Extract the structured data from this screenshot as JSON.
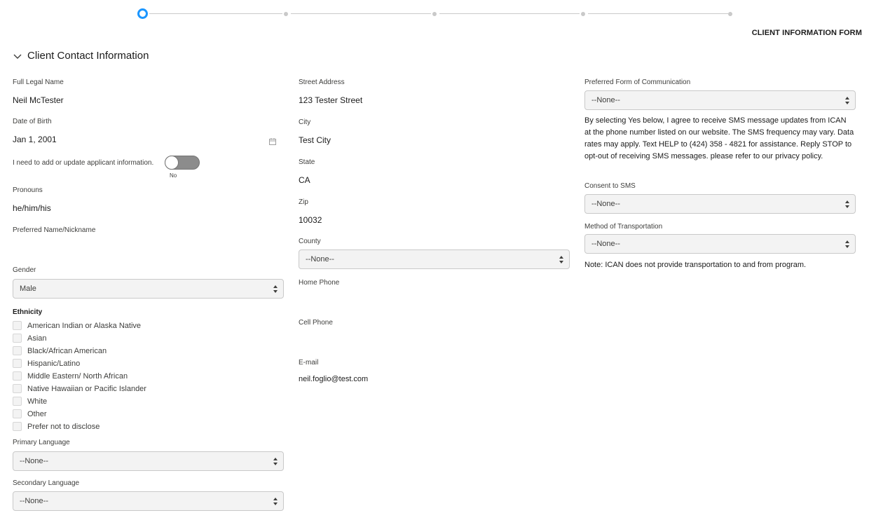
{
  "form_title": "CLIENT INFORMATION FORM",
  "section_title": "Client Contact Information",
  "left": {
    "full_legal_name_label": "Full Legal Name",
    "full_legal_name_value": "Neil McTester",
    "dob_label": "Date of Birth",
    "dob_value": "Jan 1, 2001",
    "toggle_label": "I need to add or update applicant information.",
    "toggle_state": "No",
    "pronouns_label": "Pronouns",
    "pronouns_value": "he/him/his",
    "nickname_label": "Preferred Name/Nickname",
    "gender_label": "Gender",
    "gender_value": "Male",
    "ethnicity_label": "Ethnicity",
    "ethnicity_options": [
      "American Indian or Alaska Native",
      "Asian",
      "Black/African American",
      "Hispanic/Latino",
      "Middle Eastern/ North African",
      "Native Hawaiian or Pacific Islander",
      "White",
      "Other",
      "Prefer not to disclose"
    ],
    "primary_language_label": "Primary Language",
    "primary_language_value": "--None--",
    "secondary_language_label": "Secondary Language",
    "secondary_language_value": "--None--"
  },
  "middle": {
    "street_label": "Street Address",
    "street_value": "123 Tester Street",
    "city_label": "City",
    "city_value": "Test City",
    "state_label": "State",
    "state_value": "CA",
    "zip_label": "Zip",
    "zip_value": "10032",
    "county_label": "County",
    "county_value": "--None--",
    "home_phone_label": "Home Phone",
    "cell_phone_label": "Cell Phone",
    "email_label": "E-mail",
    "email_value": "neil.foglio@test.com"
  },
  "right": {
    "communication_label": "Preferred Form of Communication",
    "communication_value": "--None--",
    "sms_disclaimer": "By selecting Yes below, I agree to receive SMS message updates from ICAN at the phone number listed on our website. The SMS frequency may vary. Data rates may apply. Text HELP to (424) 358 - 4821 for assistance. Reply STOP to opt-out of receiving SMS messages. please refer to our privacy policy.",
    "consent_label": "Consent to SMS",
    "consent_value": "--None--",
    "transport_label": "Method of Transportation",
    "transport_value": "--None--",
    "transport_note": "Note: ICAN does not provide transportation to and from program."
  },
  "stepper": {
    "steps": 5,
    "current_step": 1
  },
  "colors": {
    "accent": "#1b96ff",
    "toggle_off": "#8c8c8c",
    "field_bg": "#f3f3f3"
  }
}
